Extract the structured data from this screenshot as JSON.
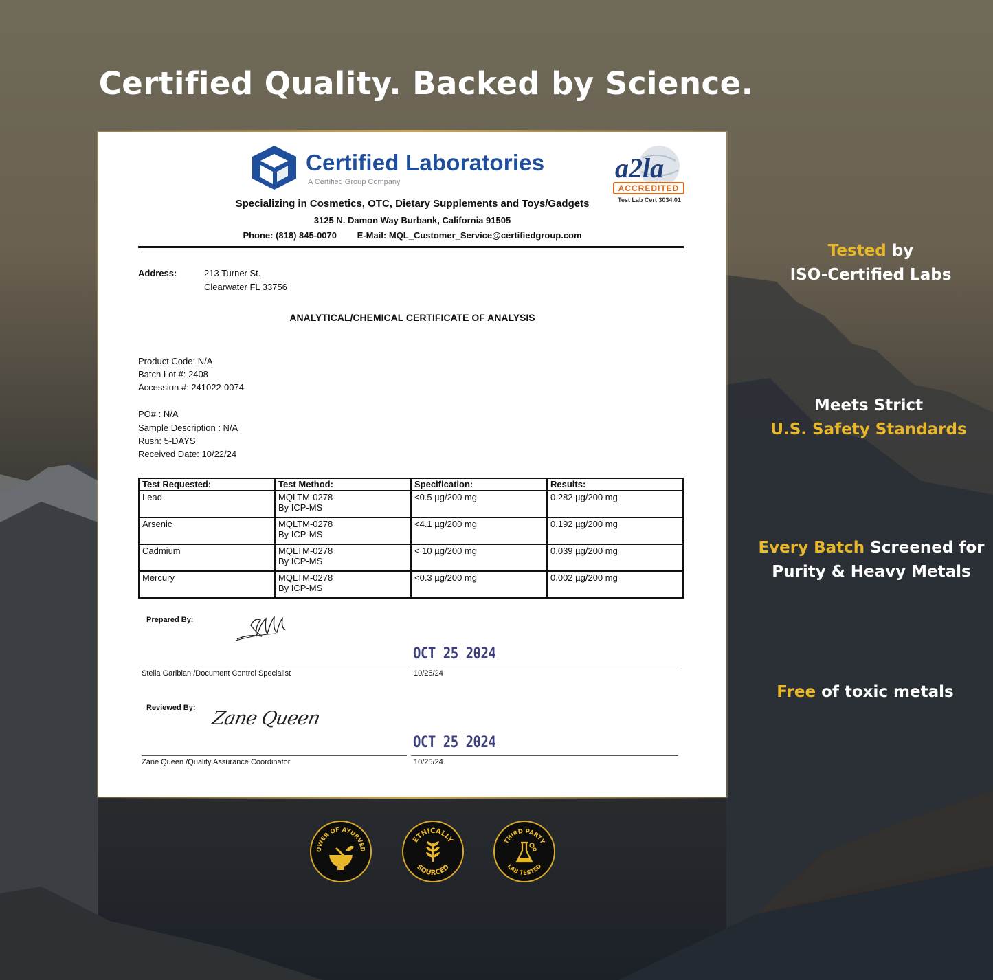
{
  "headline": "Certified Quality. Backed by Science.",
  "certificate": {
    "lab_name": "Certified Laboratories",
    "lab_subtitle": "A Certified Group Company",
    "accreditation": {
      "logo_text": "A2LA",
      "badge": "ACCREDITED",
      "cert": "Test Lab Cert 3034.01"
    },
    "specializing": "Specializing in Cosmetics, OTC, Dietary Supplements and Toys/Gadgets",
    "lab_address": "3125 N. Damon Way Burbank, California 91505",
    "phone": "Phone: (818) 845-0070",
    "email": "E-Mail: MQL_Customer_Service@certifiedgroup.com",
    "address_label": "Address:",
    "address_line1": "213 Turner St.",
    "address_line2": "Clearwater FL 33756",
    "title": "ANALYTICAL/CHEMICAL CERTIFICATE OF ANALYSIS",
    "meta": {
      "product_code": "Product Code: N/A",
      "batch_lot": "Batch Lot #: 2408",
      "accession": "Accession #: 241022-0074",
      "po": "PO# : N/A",
      "sample_description": "Sample Description : N/A",
      "rush": "Rush: 5-DAYS",
      "received_date": "Received Date: 10/22/24"
    },
    "table": {
      "headers": [
        "Test Requested:",
        "Test Method:",
        "Specification:",
        "Results:"
      ],
      "rows": [
        {
          "test": "Lead",
          "method1": "MQLTM-0278",
          "method2": "By ICP-MS",
          "spec": "<0.5 µg/200 mg",
          "result": "0.282 µg/200 mg"
        },
        {
          "test": "Arsenic",
          "method1": "MQLTM-0278",
          "method2": "By ICP-MS",
          "spec": "<4.1 µg/200 mg",
          "result": "0.192 µg/200 mg"
        },
        {
          "test": "Cadmium",
          "method1": "MQLTM-0278",
          "method2": "By ICP-MS",
          "spec": "< 10 µg/200 mg",
          "result": "0.039 µg/200 mg"
        },
        {
          "test": "Mercury",
          "method1": "MQLTM-0278",
          "method2": "By ICP-MS",
          "spec": "<0.3 µg/200 mg",
          "result": "0.002 µg/200 mg"
        }
      ]
    },
    "prepared": {
      "label": "Prepared By:",
      "stamp": "OCT 25 2024",
      "name": "Stella Garibian /Document Control Specialist",
      "date": "10/25/24"
    },
    "reviewed": {
      "label": "Reviewed By:",
      "signature": "Zane Queen",
      "stamp": "OCT 25 2024",
      "name": "Zane Queen /Quality Assurance Coordinator",
      "date": "10/25/24"
    }
  },
  "side_claims": {
    "claim1": {
      "highlight": "Tested",
      "rest": " by",
      "line2": "ISO-Certified Labs"
    },
    "claim2": {
      "line1": "Meets Strict",
      "highlight": "U.S. Safety Standards"
    },
    "claim3": {
      "highlight": "Every Batch",
      "rest": " Screened for",
      "line2": "Purity & Heavy Metals"
    },
    "claim4": {
      "highlight": "Free",
      "rest": " of toxic metals"
    }
  },
  "badges": [
    {
      "text": "POWER OF AYURVEDA",
      "icon": "mortar-pestle-icon"
    },
    {
      "top": "ETHICALLY",
      "bottom": "SOURCED",
      "icon": "leaf-icon"
    },
    {
      "top": "THIRD PARTY",
      "bottom": "LAB TESTED",
      "icon": "flask-icon"
    }
  ],
  "colors": {
    "accent_gold": "#e9b72a",
    "lab_blue": "#1f4f9c",
    "stamp": "#3d3f7c"
  }
}
